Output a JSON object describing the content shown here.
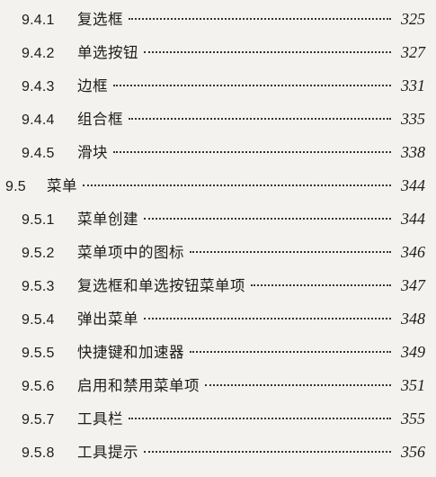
{
  "toc": {
    "entries": [
      {
        "num": "9.4.1",
        "title": "复选框",
        "page": "325",
        "level": 2
      },
      {
        "num": "9.4.2",
        "title": "单选按钮",
        "page": "327",
        "level": 2
      },
      {
        "num": "9.4.3",
        "title": "边框",
        "page": "331",
        "level": 2
      },
      {
        "num": "9.4.4",
        "title": "组合框",
        "page": "335",
        "level": 2
      },
      {
        "num": "9.4.5",
        "title": "滑块",
        "page": "338",
        "level": 2
      },
      {
        "num": "9.5",
        "title": "菜单",
        "page": "344",
        "level": 1
      },
      {
        "num": "9.5.1",
        "title": "菜单创建",
        "page": "344",
        "level": 2
      },
      {
        "num": "9.5.2",
        "title": "菜单项中的图标",
        "page": "346",
        "level": 2
      },
      {
        "num": "9.5.3",
        "title": "复选框和单选按钮菜单项",
        "page": "347",
        "level": 2
      },
      {
        "num": "9.5.4",
        "title": "弹出菜单",
        "page": "348",
        "level": 2
      },
      {
        "num": "9.5.5",
        "title": "快捷键和加速器",
        "page": "349",
        "level": 2
      },
      {
        "num": "9.5.6",
        "title": "启用和禁用菜单项",
        "page": "351",
        "level": 2
      },
      {
        "num": "9.5.7",
        "title": "工具栏",
        "page": "355",
        "level": 2
      },
      {
        "num": "9.5.8",
        "title": "工具提示",
        "page": "356",
        "level": 2
      }
    ]
  }
}
